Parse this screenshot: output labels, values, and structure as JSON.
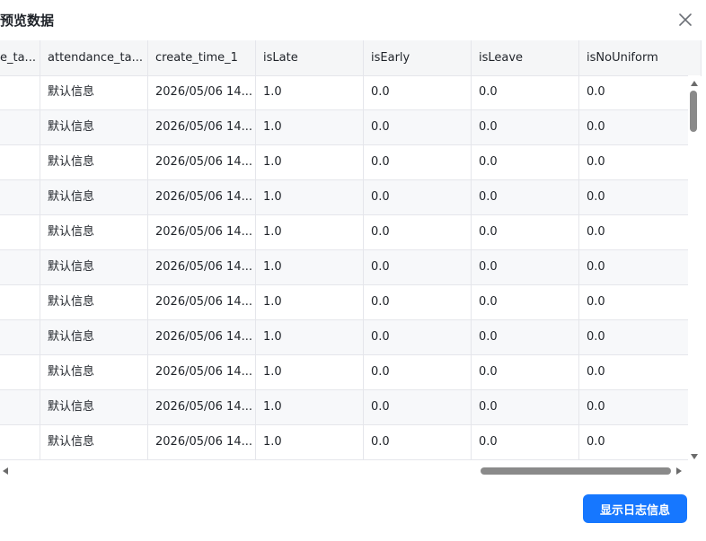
{
  "dialog": {
    "title": "预览数据",
    "button_label": "显示日志信息"
  },
  "table": {
    "columns": [
      "e_ta...",
      "attendance_ta...",
      "create_time_1",
      "isLate",
      "isEarly",
      "isLeave",
      "isNoUniform"
    ],
    "rows": [
      [
        "",
        "默认信息",
        "2026/05/06 14...",
        "1.0",
        "0.0",
        "0.0",
        "0.0"
      ],
      [
        "",
        "默认信息",
        "2026/05/06 14...",
        "1.0",
        "0.0",
        "0.0",
        "0.0"
      ],
      [
        "",
        "默认信息",
        "2026/05/06 14...",
        "1.0",
        "0.0",
        "0.0",
        "0.0"
      ],
      [
        "",
        "默认信息",
        "2026/05/06 14...",
        "1.0",
        "0.0",
        "0.0",
        "0.0"
      ],
      [
        "",
        "默认信息",
        "2026/05/06 14...",
        "1.0",
        "0.0",
        "0.0",
        "0.0"
      ],
      [
        "",
        "默认信息",
        "2026/05/06 14...",
        "1.0",
        "0.0",
        "0.0",
        "0.0"
      ],
      [
        "",
        "默认信息",
        "2026/05/06 14...",
        "1.0",
        "0.0",
        "0.0",
        "0.0"
      ],
      [
        "",
        "默认信息",
        "2026/05/06 14...",
        "1.0",
        "0.0",
        "0.0",
        "0.0"
      ],
      [
        "",
        "默认信息",
        "2026/05/06 14...",
        "1.0",
        "0.0",
        "0.0",
        "0.0"
      ],
      [
        "",
        "默认信息",
        "2026/05/06 14...",
        "1.0",
        "0.0",
        "0.0",
        "0.0"
      ],
      [
        "",
        "默认信息",
        "2026/05/06 14...",
        "1.0",
        "0.0",
        "0.0",
        "0.0"
      ]
    ]
  },
  "icons": {
    "close": "close-icon"
  },
  "colors": {
    "primary": "#1677ff",
    "header_bg": "#f5f6f7",
    "striped_row_bg": "#f7f8fa",
    "border": "#e5e6eb"
  }
}
